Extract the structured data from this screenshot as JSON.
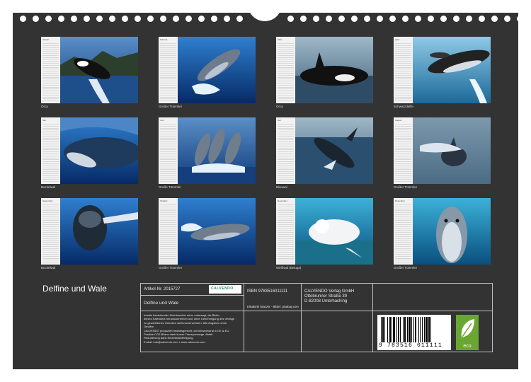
{
  "title": "Delfine und Wale",
  "months": [
    {
      "month": "Januar",
      "caption": "Orca"
    },
    {
      "month": "Februar",
      "caption": "Großer Tümmler"
    },
    {
      "month": "März",
      "caption": "Orca"
    },
    {
      "month": "April",
      "caption": "Schwarzdelfin"
    },
    {
      "month": "Mai",
      "caption": "Buckelwal"
    },
    {
      "month": "Juni",
      "caption": "Große Tümmler"
    },
    {
      "month": "Juli",
      "caption": "Blauwal"
    },
    {
      "month": "August",
      "caption": "Großer Tümmler"
    },
    {
      "month": "September",
      "caption": "Buckelwal"
    },
    {
      "month": "Oktober",
      "caption": "Großer Tümmler"
    },
    {
      "month": "November",
      "caption": "Weißwal (Beluga)"
    },
    {
      "month": "Dezember",
      "caption": "Großer Tümmler"
    }
  ],
  "info": {
    "article": "Artikel-Nr. 2015727",
    "logo": "CALVENDO",
    "product_title": "Delfine und Wale",
    "legal": [
      "Inhalte bestehender Schutzrechte ist es untersagt, die Bilder",
      "dieses Kalenders herauszutrennen und ohne Genehmigung des Verlags",
      "zu gewerblichen Zwecken weiterzuverwenden. Alle Angaben ohne",
      "Gewähr.",
      "CALVENDO produziert bedarfsgerecht und klimaneutral in DE & EU.",
      "Positive CO2-Bilanz dank kurzer Transportwege. Abfall-",
      "Reduzierung dank Einzelstückfertigung.",
      "E-Mail: info@calvendo.com • www.calvendo.com"
    ],
    "isbn": "ISBN 9783516011111",
    "credit": "Elisabeth Stanzer - Bilder: pixabay.com",
    "publisher": [
      "CALVENDO Verlag GmbH",
      "Ottobrunner Straße 39",
      "D-82008 Unterhaching"
    ],
    "barcode": "9 783516 011111",
    "eco": "eco"
  },
  "colors": {
    "background": "#333333",
    "text": "#ffffff",
    "eco": "#6aa632"
  }
}
